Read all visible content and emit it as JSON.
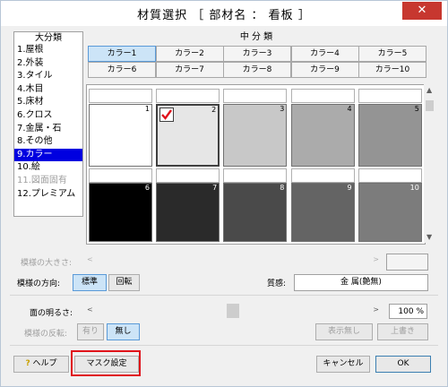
{
  "window": {
    "title": "材質選択 ［ 部材名 ： 看板 ］",
    "close_glyph": "✕"
  },
  "major": {
    "header": "大分類",
    "items": [
      {
        "label": "1.屋根",
        "state": "normal"
      },
      {
        "label": "2.外装",
        "state": "normal"
      },
      {
        "label": "3.タイル",
        "state": "normal"
      },
      {
        "label": "4.木目",
        "state": "normal"
      },
      {
        "label": "5.床材",
        "state": "normal"
      },
      {
        "label": "6.クロス",
        "state": "normal"
      },
      {
        "label": "7.金属・石",
        "state": "normal"
      },
      {
        "label": "8.その他",
        "state": "normal"
      },
      {
        "label": "9.カラー",
        "state": "selected"
      },
      {
        "label": "10.絵",
        "state": "normal"
      },
      {
        "label": "11.図面固有",
        "state": "disabled"
      },
      {
        "label": "12.プレミアム",
        "state": "normal"
      }
    ]
  },
  "middle": {
    "header": "中 分 類",
    "buttons": [
      "カラー1",
      "カラー2",
      "カラー3",
      "カラー4",
      "カラー5",
      "カラー6",
      "カラー7",
      "カラー8",
      "カラー9",
      "カラー10"
    ],
    "selected_index": 0
  },
  "swatches": [
    {
      "num": "1",
      "color": "#ffffff",
      "checked": false
    },
    {
      "num": "2",
      "color": "#e6e6e6",
      "checked": true
    },
    {
      "num": "3",
      "color": "#c8c8c8",
      "checked": false
    },
    {
      "num": "4",
      "color": "#ababab",
      "checked": false
    },
    {
      "num": "5",
      "color": "#949494",
      "checked": false
    },
    {
      "num": "6",
      "color": "#000000",
      "checked": false
    },
    {
      "num": "7",
      "color": "#2a2a2a",
      "checked": false
    },
    {
      "num": "8",
      "color": "#4a4a4a",
      "checked": false
    },
    {
      "num": "9",
      "color": "#646464",
      "checked": false
    },
    {
      "num": "10",
      "color": "#7c7c7c",
      "checked": false
    }
  ],
  "icons": {
    "check": "check-icon",
    "up": "▲",
    "down": "▼",
    "left": "<",
    "right": ">"
  },
  "pattern_size": {
    "label": "模様の大きさ:"
  },
  "pattern_direction": {
    "label": "模様の方向:",
    "btn_standard": "標準",
    "btn_rotate": "回転"
  },
  "texture": {
    "label": "質感:",
    "value": "金 属(艶無)"
  },
  "brightness": {
    "label": "面の明るさ:",
    "value": "100 %",
    "fraction": 0.5
  },
  "pattern_flip": {
    "label": "模様の反転:",
    "btn_yes": "有り",
    "btn_no": "無し"
  },
  "actions": {
    "no_display": "表示無し",
    "overwrite": "上書き"
  },
  "footer": {
    "help": "ヘルプ",
    "mask_settings": "マスク設定",
    "cancel": "キャンセル",
    "ok": "OK"
  },
  "colors": {
    "selection": "#0000e0",
    "highlight_border": "#e0101a",
    "check": "#e0101a"
  }
}
